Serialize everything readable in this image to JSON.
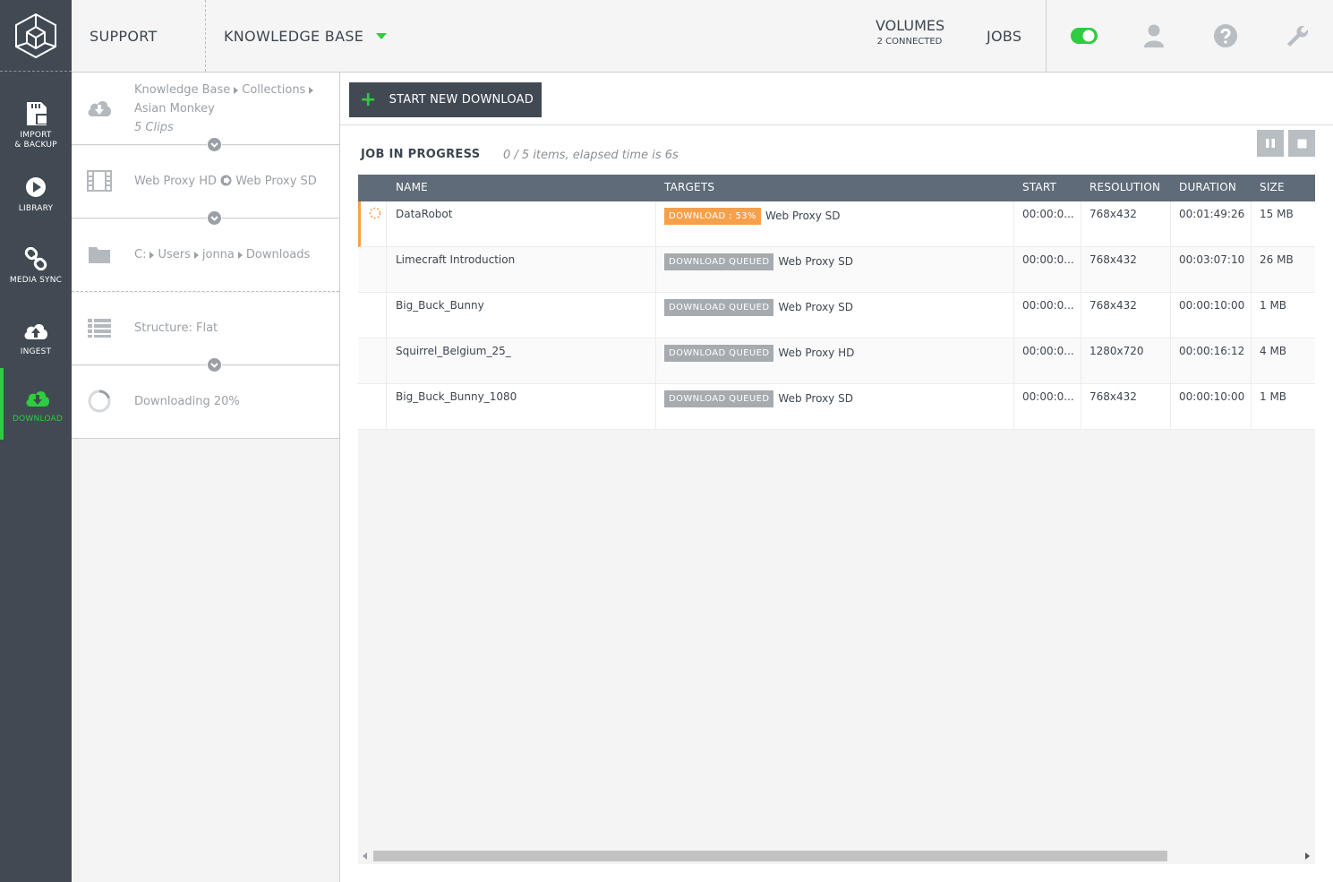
{
  "rail": {
    "items": [
      {
        "label_1": "IMPORT",
        "label_2": "& BACKUP",
        "icon": "sd-card-icon"
      },
      {
        "label_1": "LIBRARY",
        "icon": "play-icon"
      },
      {
        "label_1": "MEDIA SYNC",
        "icon": "link-icon"
      },
      {
        "label_1": "INGEST",
        "icon": "cloud-upload-icon"
      },
      {
        "label_1": "DOWNLOAD",
        "icon": "cloud-download-icon",
        "active": true
      }
    ]
  },
  "topbar": {
    "support": "SUPPORT",
    "knowledge_base": "KNOWLEDGE BASE",
    "volumes": "VOLUMES",
    "volumes_sub": "2 CONNECTED",
    "jobs": "JOBS"
  },
  "wizard": {
    "source": {
      "crumb_1": "Knowledge Base",
      "crumb_2": "Collections",
      "item": "Asian Monkey",
      "clips": "5 Clips"
    },
    "transcode": {
      "from": "Web Proxy HD",
      "to": "Web Proxy SD"
    },
    "destination": {
      "parts": [
        "C:",
        "Users",
        "jonna",
        "Downloads"
      ]
    },
    "structure": "Structure: Flat",
    "progress": "Downloading 20%"
  },
  "main": {
    "start_button": "START NEW DOWNLOAD",
    "job_title": "JOB IN PROGRESS",
    "job_status": "0 / 5  items, elapsed time is 6s"
  },
  "table": {
    "columns": {
      "name": "NAME",
      "targets": "TARGETS",
      "start": "START",
      "resolution": "RESOLUTION",
      "duration": "DURATION",
      "size": "SIZE"
    },
    "rows": [
      {
        "name": "DataRobot",
        "badge": "DOWNLOAD : 53%",
        "target": "Web Proxy SD",
        "start": "00:00:0...",
        "resolution": "768x432",
        "duration": "00:01:49:26",
        "size": "15 MB"
      },
      {
        "name": "Limecraft Introduction",
        "badge": "DOWNLOAD  QUEUED",
        "target": "Web Proxy SD",
        "start": "00:00:0...",
        "resolution": "768x432",
        "duration": "00:03:07:10",
        "size": "26 MB"
      },
      {
        "name": "Big_Buck_Bunny",
        "badge": "DOWNLOAD  QUEUED",
        "target": "Web Proxy SD",
        "start": "00:00:0...",
        "resolution": "768x432",
        "duration": "00:00:10:00",
        "size": "1 MB"
      },
      {
        "name": "Squirrel_Belgium_25_",
        "badge": "DOWNLOAD  QUEUED",
        "target": "Web Proxy HD",
        "start": "00:00:0...",
        "resolution": "1280x720",
        "duration": "00:00:16:12",
        "size": "4 MB"
      },
      {
        "name": "Big_Buck_Bunny_1080",
        "badge": "DOWNLOAD  QUEUED",
        "target": "Web Proxy SD",
        "start": "00:00:0...",
        "resolution": "768x432",
        "duration": "00:00:10:00",
        "size": "1 MB"
      }
    ]
  },
  "colors": {
    "accent": "#2ecc40",
    "rail": "#414a53",
    "header": "#5f6b78",
    "progress_badge": "#f7a04b",
    "queued_badge": "#a6abb0"
  }
}
